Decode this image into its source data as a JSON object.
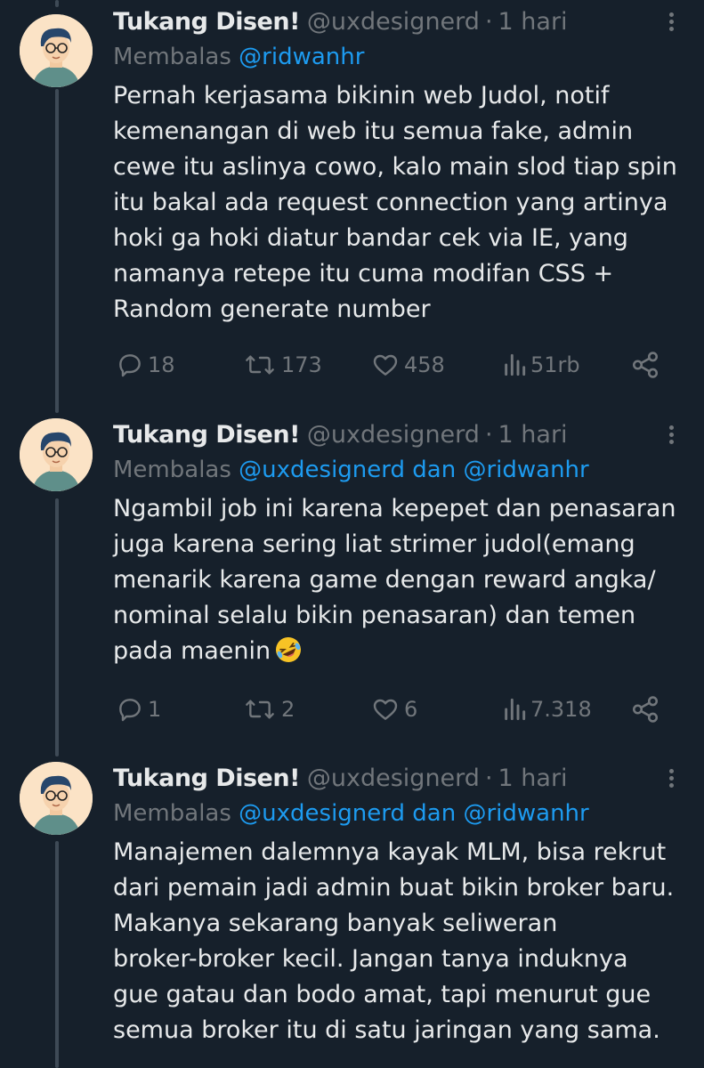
{
  "colors": {
    "background": "#16202b",
    "text": "#e7e9ea",
    "muted": "#71767b",
    "mention": "#1d9bf0"
  },
  "tweets": [
    {
      "name": "Tukang Disen!",
      "handle": "@uxdesignerd",
      "dot": "·",
      "time": "1 hari",
      "reply_prefix": "Membalas",
      "reply_to": "@ridwanhr",
      "lines": [
        "Pernah kerjasama bikinin web Judol, notif",
        "kemenangan di web itu semua fake, admin",
        "cewe itu aslinya cowo, kalo main slod tiap spin",
        "itu bakal ada request connection yang artinya",
        "hoki ga hoki diatur bandar cek via IE, yang",
        "namanya retepe itu cuma modifan CSS +",
        "Random generate number"
      ],
      "stats": {
        "replies": "18",
        "reposts": "173",
        "likes": "458",
        "views": "51rb"
      }
    },
    {
      "name": "Tukang Disen!",
      "handle": "@uxdesignerd",
      "dot": "·",
      "time": "1 hari",
      "reply_prefix": "Membalas",
      "reply_to": "@uxdesignerd dan @ridwanhr",
      "lines": [
        "Ngambil job ini karena kepepet dan penasaran",
        "juga karena sering liat strimer judol(emang",
        "menarik karena game dengan reward angka/",
        "nominal selalu bikin penasaran) dan temen",
        "pada maenin"
      ],
      "emoji": "rolling-on-floor-laughing",
      "stats": {
        "replies": "1",
        "reposts": "2",
        "likes": "6",
        "views": "7.318"
      }
    },
    {
      "name": "Tukang Disen!",
      "handle": "@uxdesignerd",
      "dot": "·",
      "time": "1 hari",
      "reply_prefix": "Membalas",
      "reply_to": "@uxdesignerd dan @ridwanhr",
      "lines": [
        "Manajemen dalemnya kayak MLM, bisa rekrut",
        "dari pemain jadi admin buat bikin broker baru.",
        "Makanya sekarang banyak seliweran",
        "broker-broker kecil. Jangan tanya induknya",
        "gue gatau dan bodo amat, tapi menurut gue",
        "semua broker itu di satu jaringan yang sama."
      ]
    }
  ]
}
